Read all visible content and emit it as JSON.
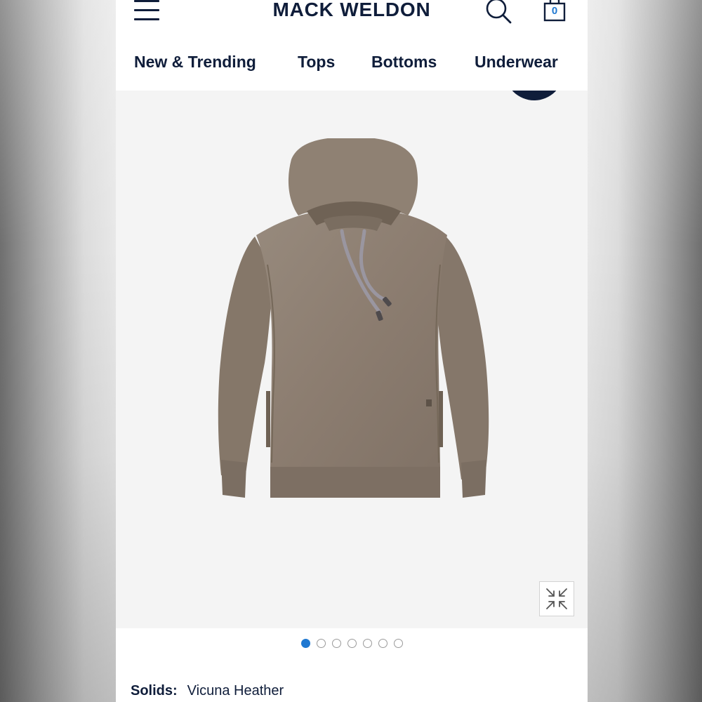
{
  "header": {
    "brand": "MACK WELDON",
    "cart_count": "0"
  },
  "nav": {
    "items": [
      "New & Trending",
      "Tops",
      "Bottoms",
      "Underwear"
    ]
  },
  "product": {
    "image_icon": "hoodie-image",
    "expand_icon": "expand-arrows-icon",
    "color_label": "Solids:",
    "color_value": "Vicuna Heather"
  },
  "carousel": {
    "total_slides": 7,
    "active_index": 0
  },
  "colors": {
    "navy": "#0f1d3a",
    "accent_blue": "#1f78d1",
    "hoodie": "#8c7d70"
  }
}
